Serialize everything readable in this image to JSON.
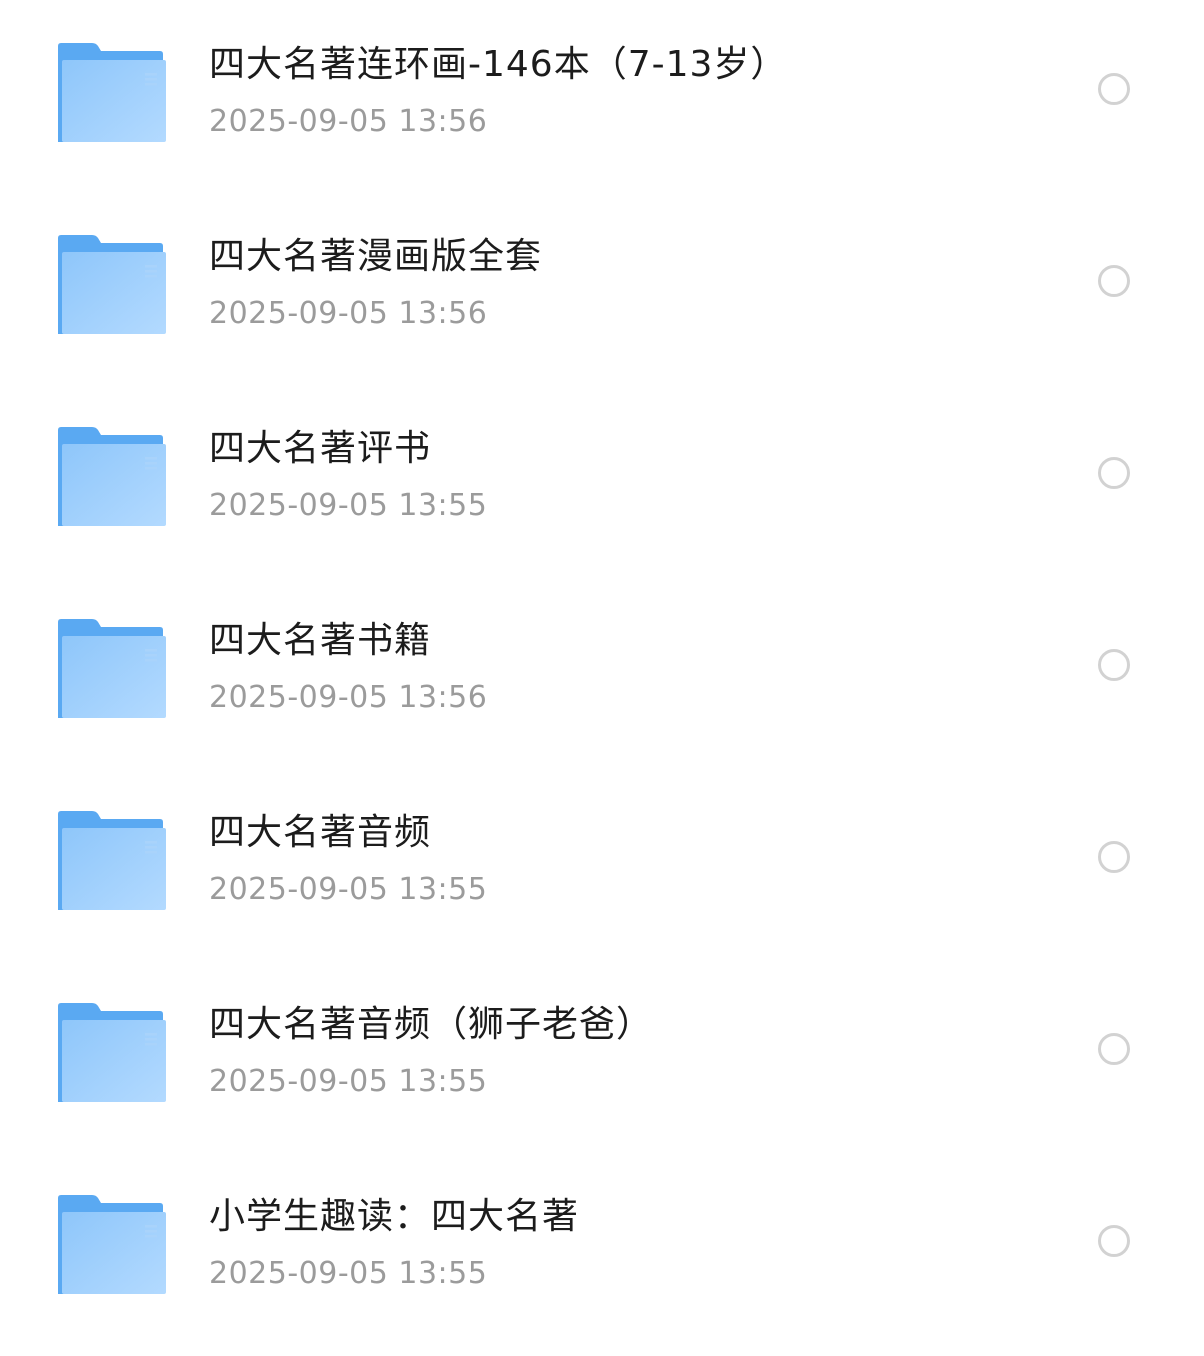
{
  "colors": {
    "folder_back": "#5aa9f2",
    "folder_front_top": "#8ec6fa",
    "folder_front_bottom": "#b3daff",
    "name_text": "#1c1c1c",
    "date_text": "#9b9b9b",
    "radio_border": "#d2d2d2"
  },
  "folders": [
    {
      "name": "四大名著连环画-146本（7-13岁）",
      "date": "2025-09-05 13:56",
      "icon": "folder-icon",
      "selected": false
    },
    {
      "name": "四大名著漫画版全套",
      "date": "2025-09-05 13:56",
      "icon": "folder-icon",
      "selected": false
    },
    {
      "name": "四大名著评书",
      "date": "2025-09-05 13:55",
      "icon": "folder-icon",
      "selected": false
    },
    {
      "name": "四大名著书籍",
      "date": "2025-09-05 13:56",
      "icon": "folder-icon",
      "selected": false
    },
    {
      "name": "四大名著音频",
      "date": "2025-09-05 13:55",
      "icon": "folder-icon",
      "selected": false
    },
    {
      "name": "四大名著音频（狮子老爸）",
      "date": "2025-09-05 13:55",
      "icon": "folder-icon",
      "selected": false
    },
    {
      "name": "小学生趣读：四大名著",
      "date": "2025-09-05 13:55",
      "icon": "folder-icon",
      "selected": false
    }
  ]
}
